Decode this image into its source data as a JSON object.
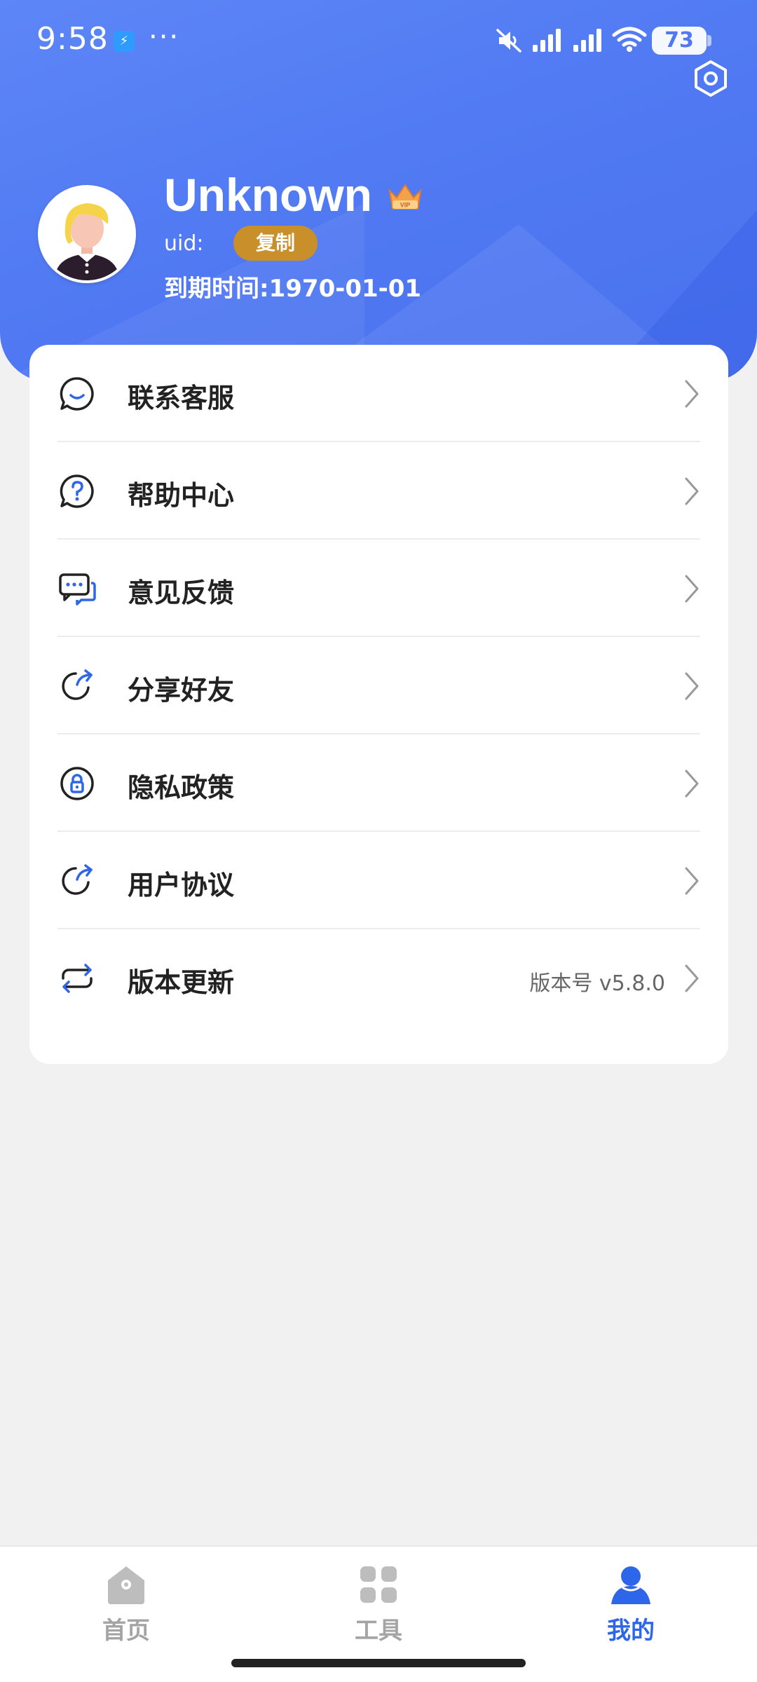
{
  "status_bar": {
    "time": "9:58",
    "dots": "···",
    "battery": "73",
    "icons": [
      "app-notification-icon",
      "mute-icon",
      "signal-icon",
      "signal-icon",
      "wifi-icon",
      "battery-icon"
    ]
  },
  "profile": {
    "username": "Unknown",
    "badge_icon": "vip-crown-icon",
    "uid_label": "uid:",
    "copy_label": "复制",
    "expire_text": "到期时间:1970-01-01"
  },
  "menu": {
    "items": [
      {
        "label": "联系客服",
        "icon": "chat-bubble-icon"
      },
      {
        "label": "帮助中心",
        "icon": "help-icon"
      },
      {
        "label": "意见反馈",
        "icon": "feedback-icon"
      },
      {
        "label": "分享好友",
        "icon": "share-icon"
      },
      {
        "label": "隐私政策",
        "icon": "privacy-lock-icon"
      },
      {
        "label": "用户协议",
        "icon": "agreement-icon"
      },
      {
        "label": "版本更新",
        "icon": "update-icon",
        "value": "版本号 v5.8.0"
      }
    ]
  },
  "tabs": [
    {
      "label": "首页",
      "icon": "home-icon",
      "active": false
    },
    {
      "label": "工具",
      "icon": "tools-grid-icon",
      "active": false
    },
    {
      "label": "我的",
      "icon": "profile-icon",
      "active": true
    }
  ],
  "colors": {
    "header_blue": "#4f78f2",
    "accent_blue": "#2d66e8",
    "copy_gold": "#c98f2a",
    "background": "#f1f1f1"
  }
}
